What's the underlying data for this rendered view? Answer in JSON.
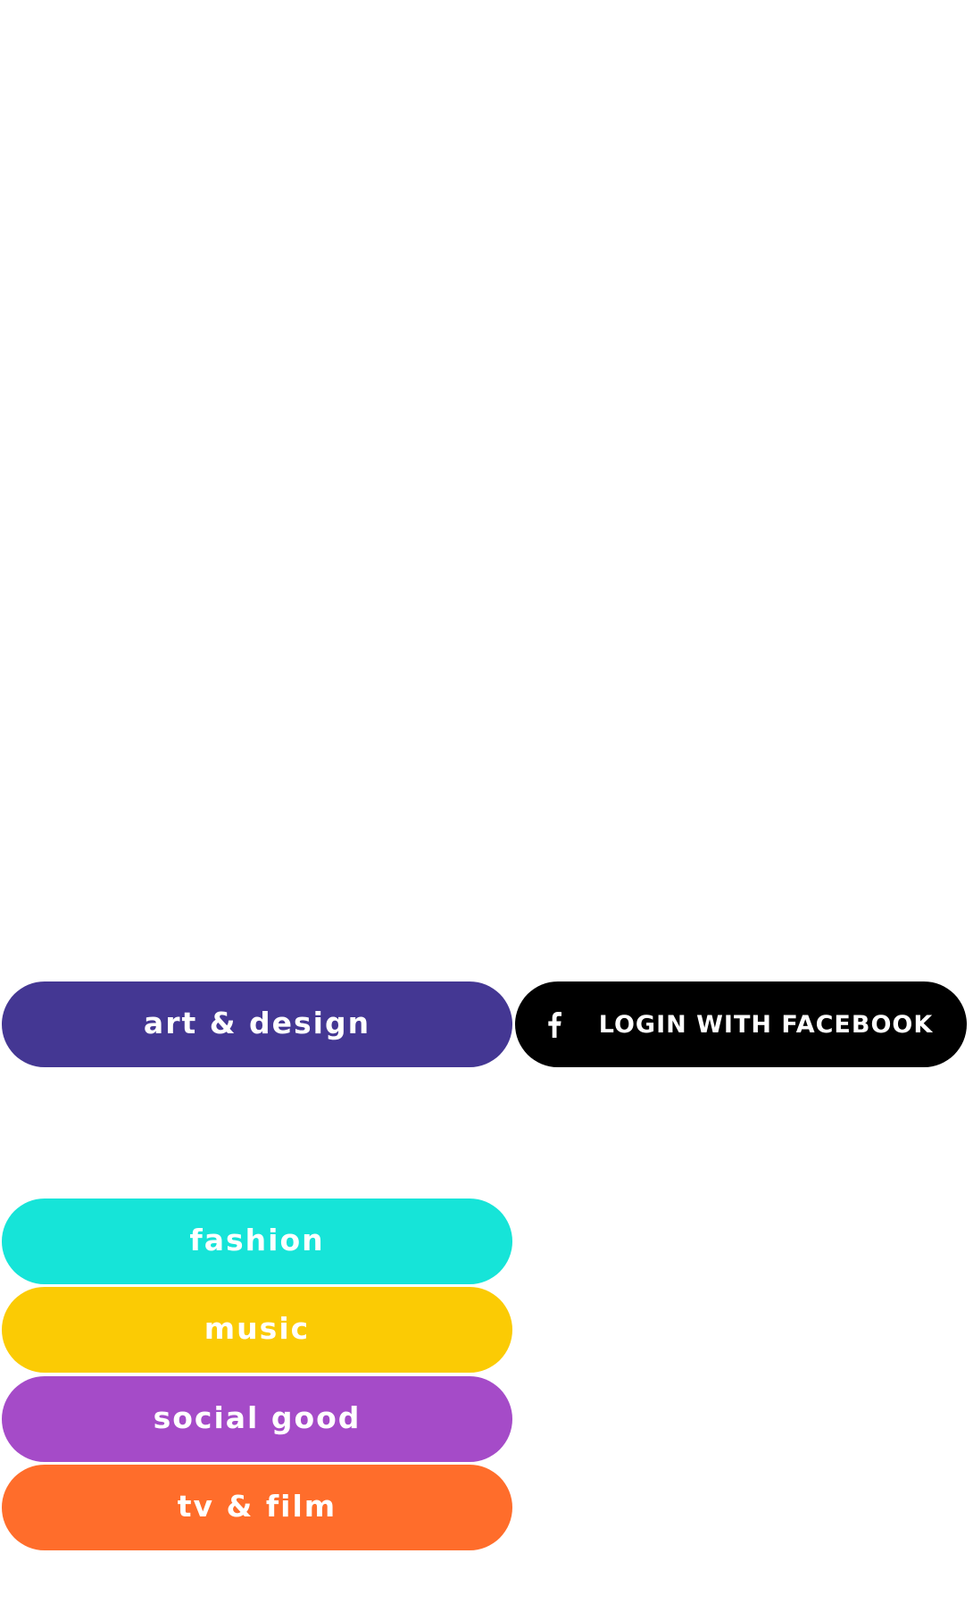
{
  "categories": [
    {
      "label": "art & design",
      "color": "#443793"
    },
    {
      "label": "fashion",
      "color": "#16e4d8"
    },
    {
      "label": "music",
      "color": "#fbcb04"
    },
    {
      "label": "social good",
      "color": "#a54bc8"
    },
    {
      "label": "tv & film",
      "color": "#ff6d2b"
    }
  ],
  "facebook_login": {
    "label": "LOGIN WITH FACEBOOK",
    "icon": "facebook-f-icon",
    "color": "#000000"
  }
}
